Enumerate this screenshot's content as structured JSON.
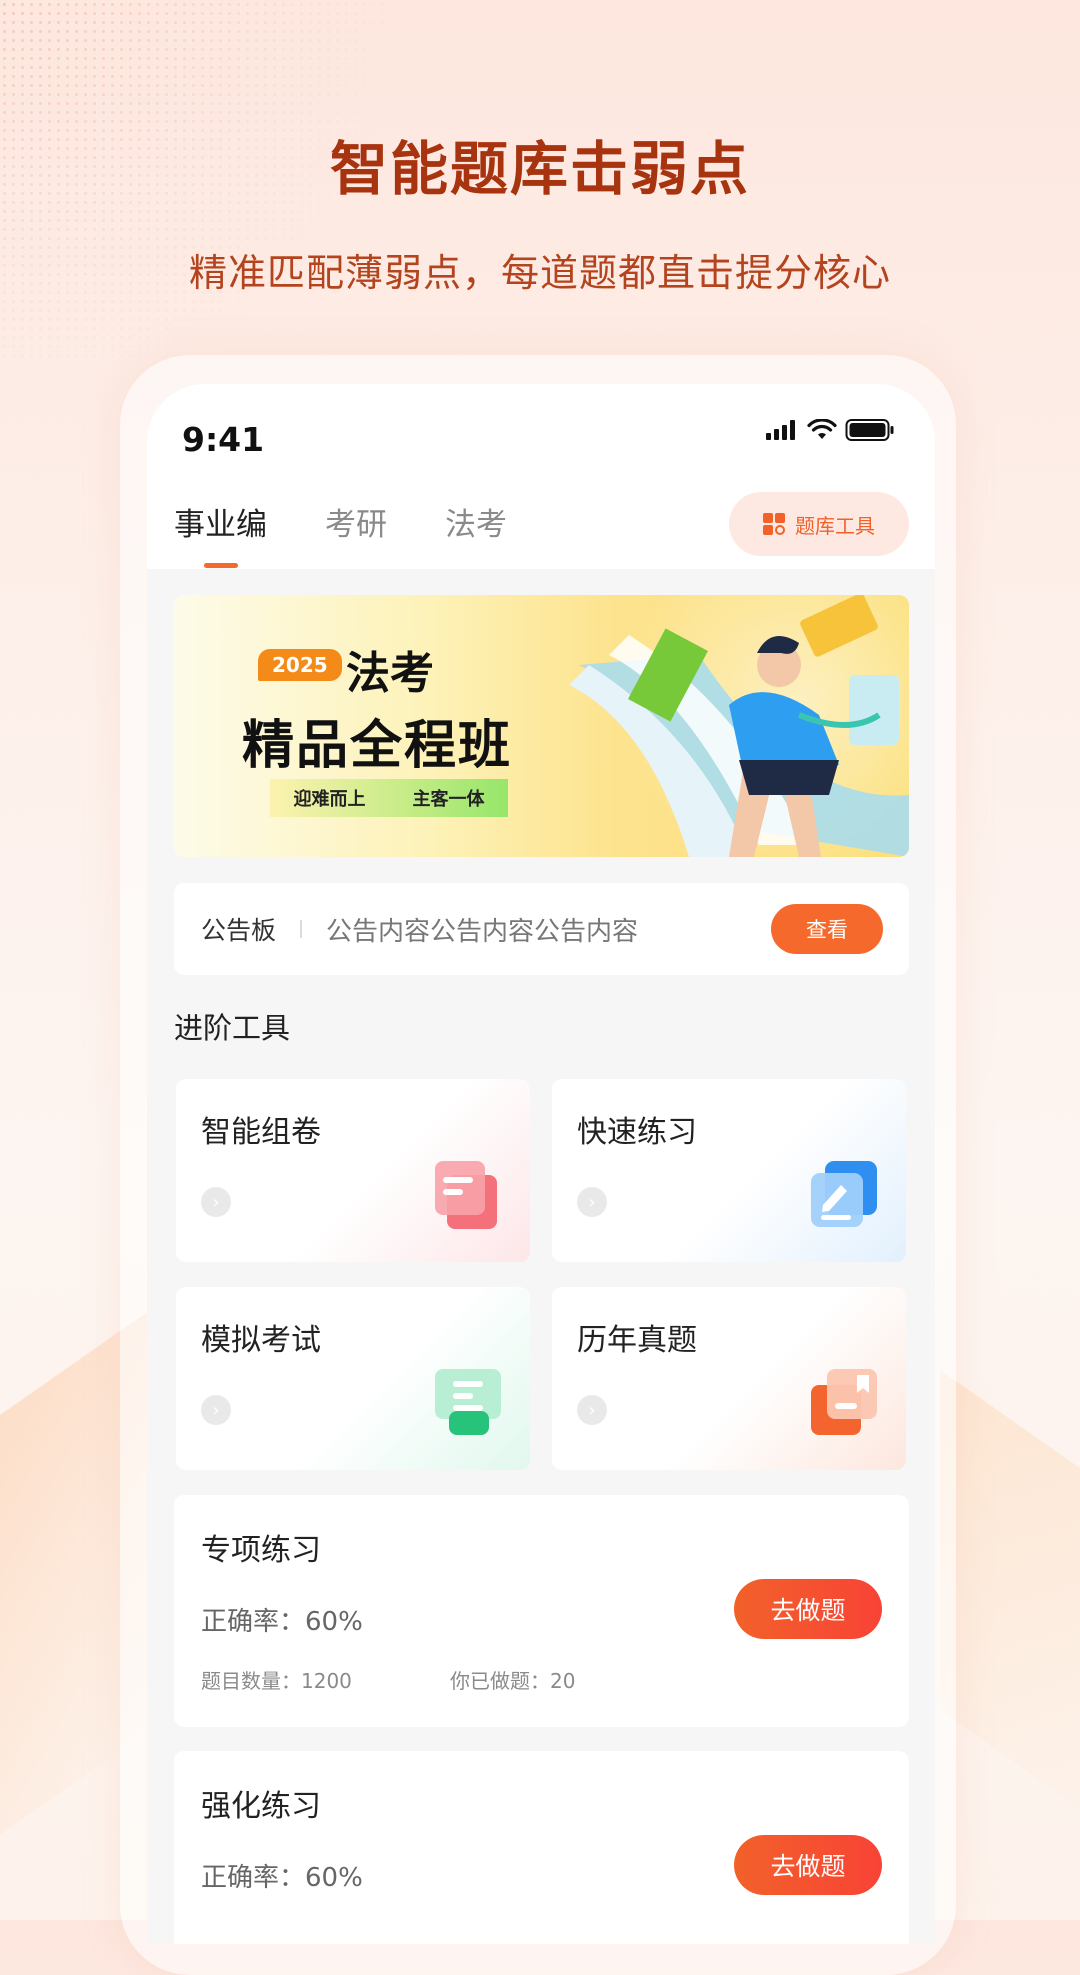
{
  "hero": {
    "title": "智能题库击弱点",
    "subtitle": "精准匹配薄弱点，每道题都直击提分核心"
  },
  "status_bar": {
    "time": "9:41",
    "icons": [
      "signal-icon",
      "wifi-icon",
      "battery-icon"
    ]
  },
  "tabs": [
    {
      "label": "事业编",
      "active": true
    },
    {
      "label": "考研",
      "active": false
    },
    {
      "label": "法考",
      "active": false
    }
  ],
  "tool_button": {
    "label": "题库工具",
    "icon": "grid-icon"
  },
  "banner": {
    "year": "2025",
    "title_line1": "法考",
    "title_line2": "精品全程班",
    "tag_left": "迎难而上",
    "tag_right": "主客一体"
  },
  "notice": {
    "label": "公告板",
    "text": "公告内容公告内容公告内容",
    "button": "查看"
  },
  "tools_section": {
    "title": "进阶工具",
    "cards": [
      {
        "label": "智能组卷",
        "icon": "compose-paper-icon",
        "color": "#f25b66"
      },
      {
        "label": "快速练习",
        "icon": "edit-practice-icon",
        "color": "#2f8ff0"
      },
      {
        "label": "模拟考试",
        "icon": "mock-exam-icon",
        "color": "#27c37a"
      },
      {
        "label": "历年真题",
        "icon": "past-papers-icon",
        "color": "#f4642e"
      }
    ]
  },
  "practice": [
    {
      "title": "专项练习",
      "accuracy": "正确率：60%",
      "count": "题目数量：1200",
      "done": "你已做题：20",
      "button": "去做题"
    },
    {
      "title": "强化练习",
      "accuracy": "正确率：60%",
      "button": "去做题"
    }
  ],
  "colors": {
    "accent": "#f56a2c",
    "hero_title": "#a8330f",
    "hero_subtitle": "#b4441d"
  }
}
